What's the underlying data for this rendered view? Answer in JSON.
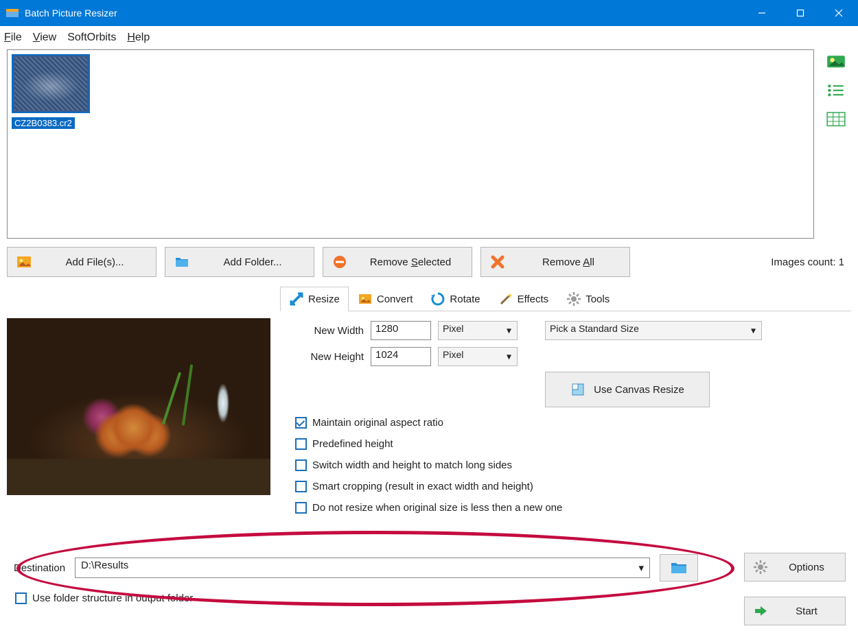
{
  "title": "Batch Picture Resizer",
  "menu": {
    "file": "File",
    "view": "View",
    "softorbits": "SoftOrbits",
    "help": "Help"
  },
  "thumb": {
    "filename": "CZ2B0383.cr2"
  },
  "actions": {
    "add_files": "Add File(s)...",
    "add_folder": "Add Folder...",
    "remove_selected": "Remove Selected",
    "remove_all": "Remove All"
  },
  "images_count_label": "Images count: 1",
  "tabs": {
    "resize": "Resize",
    "convert": "Convert",
    "rotate": "Rotate",
    "effects": "Effects",
    "tools": "Tools"
  },
  "resize": {
    "new_width_label": "New Width",
    "new_width_value": "1280",
    "width_unit": "Pixel",
    "new_height_label": "New Height",
    "new_height_value": "1024",
    "height_unit": "Pixel",
    "standard_size": "Pick a Standard Size",
    "canvas_button": "Use Canvas Resize",
    "maintain_aspect": "Maintain original aspect ratio",
    "predefined_height": "Predefined height",
    "switch_wh": "Switch width and height to match long sides",
    "smart_crop": "Smart cropping (result in exact width and height)",
    "no_resize_smaller": "Do not resize when original size is less then a new one"
  },
  "destination": {
    "label": "Destination",
    "value": "D:\\Results"
  },
  "use_folder_structure": "Use folder structure in output folder",
  "options_btn": "Options",
  "start_btn": "Start"
}
